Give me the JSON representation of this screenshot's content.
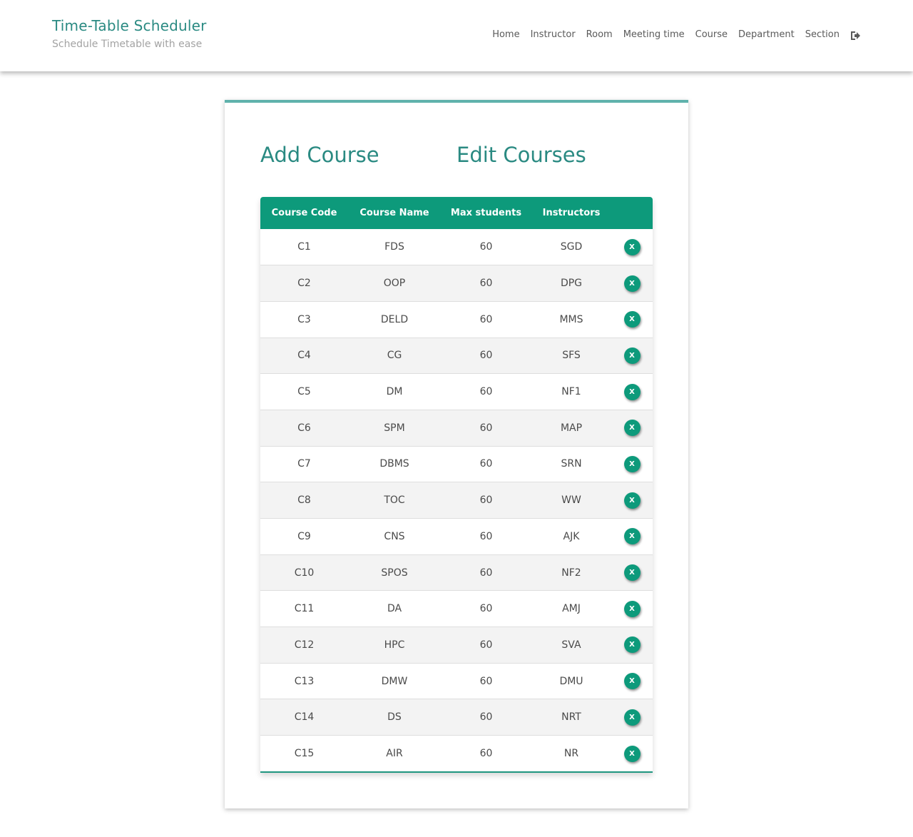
{
  "header": {
    "title": "Time-Table Scheduler",
    "subtitle": "Schedule Timetable with ease",
    "nav": [
      "Home",
      "Instructor",
      "Room",
      "Meeting time",
      "Course",
      "Department",
      "Section"
    ],
    "logout_icon": "sign-out-icon"
  },
  "tabs": {
    "add_label": "Add Course",
    "edit_label": "Edit Courses"
  },
  "table": {
    "headers": [
      "Course Code",
      "Course Name",
      "Max students",
      "Instructors"
    ],
    "delete_label": "X",
    "rows": [
      {
        "code": "C1",
        "name": "FDS",
        "max": "60",
        "instructor": "SGD"
      },
      {
        "code": "C2",
        "name": "OOP",
        "max": "60",
        "instructor": "DPG"
      },
      {
        "code": "C3",
        "name": "DELD",
        "max": "60",
        "instructor": "MMS"
      },
      {
        "code": "C4",
        "name": "CG",
        "max": "60",
        "instructor": "SFS"
      },
      {
        "code": "C5",
        "name": "DM",
        "max": "60",
        "instructor": "NF1"
      },
      {
        "code": "C6",
        "name": "SPM",
        "max": "60",
        "instructor": "MAP"
      },
      {
        "code": "C7",
        "name": "DBMS",
        "max": "60",
        "instructor": "SRN"
      },
      {
        "code": "C8",
        "name": "TOC",
        "max": "60",
        "instructor": "WW"
      },
      {
        "code": "C9",
        "name": "CNS",
        "max": "60",
        "instructor": "AJK"
      },
      {
        "code": "C10",
        "name": "SPOS",
        "max": "60",
        "instructor": "NF2"
      },
      {
        "code": "C11",
        "name": "DA",
        "max": "60",
        "instructor": "AMJ"
      },
      {
        "code": "C12",
        "name": "HPC",
        "max": "60",
        "instructor": "SVA"
      },
      {
        "code": "C13",
        "name": "DMW",
        "max": "60",
        "instructor": "DMU"
      },
      {
        "code": "C14",
        "name": "DS",
        "max": "60",
        "instructor": "NRT"
      },
      {
        "code": "C15",
        "name": "AIR",
        "max": "60",
        "instructor": "NR"
      }
    ]
  },
  "colors": {
    "accent": "#2a8a82",
    "header_bg": "#0d9a7b",
    "card_top_border": "#5fb2ac"
  }
}
